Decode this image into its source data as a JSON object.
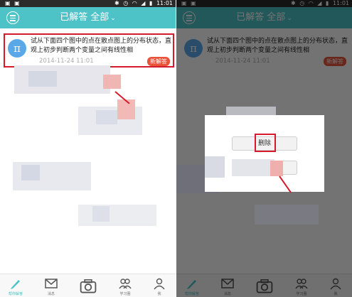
{
  "header": {
    "title": "已解答",
    "filter_value": "全部"
  },
  "status_bar": {
    "time": "11:01"
  },
  "question_card": {
    "text": "试从下面四个图中的点在散点图上的分布状态，直观上初步判断两个变量之间有线性相",
    "timestamp": "2014-11-24 11:01",
    "badge": "新解答",
    "avatar_glyph": "π"
  },
  "bottom_nav": {
    "items": [
      {
        "label": "帮你解答",
        "icon": "pencil-icon"
      },
      {
        "label": "消息",
        "icon": "mail-icon"
      },
      {
        "label": "",
        "icon": "camera-icon"
      },
      {
        "label": "学习圈",
        "icon": "people-icon"
      },
      {
        "label": "我",
        "icon": "person-icon"
      }
    ]
  },
  "dialog": {
    "delete_label": "删除",
    "second_label": ""
  },
  "colors": {
    "header": "#4ec3c7",
    "highlight": "#d51b2b",
    "badge": "#e8543a",
    "avatar": "#5aa8e8"
  }
}
